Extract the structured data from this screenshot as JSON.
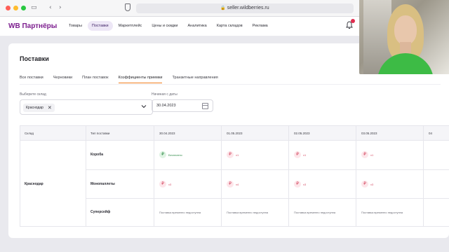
{
  "browser": {
    "url": "seller.wildberries.ru"
  },
  "app": {
    "brand": "WB Партнёры",
    "nav": [
      {
        "label": "Товары"
      },
      {
        "label": "Поставки"
      },
      {
        "label": "Маркетплейс"
      },
      {
        "label": "Цены и скидки"
      },
      {
        "label": "Аналитика"
      },
      {
        "label": "Карта складов"
      },
      {
        "label": "Реклама"
      }
    ],
    "active_nav": "Поставки",
    "icons": {
      "notifications": "bell-icon"
    },
    "colors": {
      "brand": "#7d1f8f",
      "accent": "#f27e1c",
      "free": "#2e8b47",
      "paid": "#d44a63"
    }
  },
  "page": {
    "title": "Поставки",
    "tabs": [
      {
        "label": "Все поставки"
      },
      {
        "label": "Черновики"
      },
      {
        "label": "План поставок"
      },
      {
        "label": "Коэффициенты приемки"
      },
      {
        "label": "Транзитные направления"
      }
    ],
    "active_tab": "Коэффициенты приемки",
    "filters": {
      "warehouse_label": "Выберите склад",
      "warehouse_chip": "Краснодар",
      "date_label": "Начиная с даты",
      "date_value": "30.04.2023"
    },
    "table": {
      "headers": {
        "warehouse": "Склад",
        "supply_type": "Тип поставки",
        "dates": [
          "30.04.2023",
          "01.05.2023",
          "02.05.2023",
          "03.05.2023",
          "04"
        ]
      },
      "warehouse": "Краснодар",
      "rows": [
        {
          "type": "Короба",
          "cells": [
            {
              "kind": "free",
              "text": "Бесплатно"
            },
            {
              "kind": "paid",
              "text": "x1"
            },
            {
              "kind": "paid",
              "text": "x1"
            },
            {
              "kind": "paid",
              "text": "x1"
            }
          ]
        },
        {
          "type": "Монопаллеты",
          "cells": [
            {
              "kind": "paid",
              "text": "x3"
            },
            {
              "kind": "paid",
              "text": "x4"
            },
            {
              "kind": "paid",
              "text": "x3"
            },
            {
              "kind": "paid",
              "text": "x3"
            }
          ]
        },
        {
          "type": "Суперсейф",
          "cells": [
            {
              "kind": "na",
              "text": "Поставка временно недоступна"
            },
            {
              "kind": "na",
              "text": "Поставка временно недоступна"
            },
            {
              "kind": "na",
              "text": "Поставка временно недоступна"
            },
            {
              "kind": "na",
              "text": "Поставка временно недоступна"
            }
          ]
        }
      ],
      "currency_symbol": "₽"
    }
  }
}
